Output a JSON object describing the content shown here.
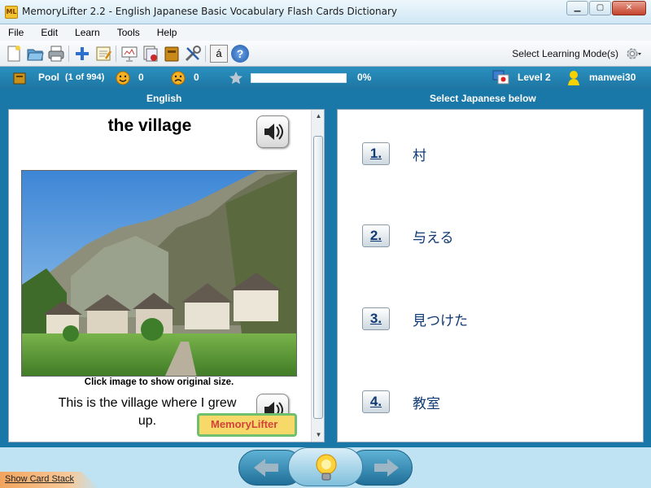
{
  "window": {
    "app_icon": "ML",
    "title": "MemoryLifter 2.2 - English Japanese Basic Vocabulary Flash Cards Dictionary",
    "controls": [
      "minimize",
      "maximize",
      "close"
    ]
  },
  "menu": [
    "File",
    "Edit",
    "Learn",
    "Tools",
    "Help"
  ],
  "toolbar": {
    "icons": [
      "new-document-icon",
      "open-folder-icon",
      "print-icon",
      "add-card-icon",
      "edit-card-icon",
      "slideshow-icon",
      "card-stack-icon",
      "dictionary-icon",
      "tools-icon",
      "accent-char-icon",
      "help-icon"
    ],
    "learning_mode_label": "Select Learning Mode(s)",
    "accent_char": "á",
    "help_char": "?"
  },
  "status": {
    "pool_label": "Pool",
    "pool_count": "(1 of 994)",
    "correct_count": "0",
    "wrong_count": "0",
    "progress_percent_label": "0%",
    "progress_fraction": 0,
    "level": "Level 2",
    "user": "manwei30"
  },
  "question": {
    "header": "English",
    "word": "the village",
    "image_caption": "Click image to show original size.",
    "example": "This is the village where I grew up.",
    "logo_text": "MemoryLifter"
  },
  "answers": {
    "header": "Select Japanese below",
    "items": [
      {
        "num": "1.",
        "text": "村"
      },
      {
        "num": "2.",
        "text": "与える"
      },
      {
        "num": "3.",
        "text": "見つけた"
      },
      {
        "num": "4.",
        "text": "教室"
      }
    ]
  },
  "bottom": {
    "show_card_stack": "Show Card Stack"
  },
  "colors": {
    "accent": "#1a78a8",
    "answer_text": "#103a73"
  }
}
